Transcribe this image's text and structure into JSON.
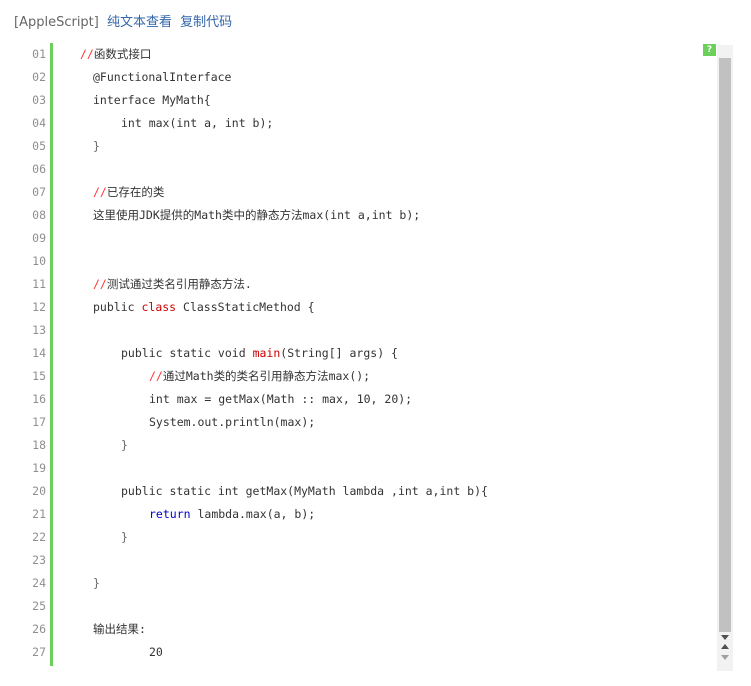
{
  "header": {
    "language": "[AppleScript]",
    "view_plain_link": "纯文本查看",
    "copy_link": "复制代码"
  },
  "badge": {
    "label": "?"
  },
  "lines": [
    {
      "num": "01",
      "indent": 0,
      "segments": [
        {
          "t": "//",
          "c": "c-comment-slash"
        },
        {
          "t": "函数式接口",
          "c": "c-plain cjk"
        }
      ]
    },
    {
      "num": "02",
      "indent": 1,
      "segments": [
        {
          "t": "@FunctionalInterface",
          "c": "c-plain"
        }
      ]
    },
    {
      "num": "03",
      "indent": 1,
      "segments": [
        {
          "t": "interface MyMath{",
          "c": "c-plain"
        }
      ]
    },
    {
      "num": "04",
      "indent": 2,
      "segments": [
        {
          "t": "int max(int a, int b);",
          "c": "c-plain"
        }
      ]
    },
    {
      "num": "05",
      "indent": 1,
      "segments": [
        {
          "t": "}",
          "c": "c-gray"
        }
      ]
    },
    {
      "num": "06",
      "indent": 1,
      "segments": []
    },
    {
      "num": "07",
      "indent": 1,
      "segments": [
        {
          "t": "//",
          "c": "c-comment-slash"
        },
        {
          "t": "已存在的类",
          "c": "c-plain cjk"
        }
      ]
    },
    {
      "num": "08",
      "indent": 1,
      "segments": [
        {
          "t": "这里使用",
          "c": "c-plain cjk"
        },
        {
          "t": "JDK",
          "c": "c-plain"
        },
        {
          "t": "提供的",
          "c": "c-plain cjk"
        },
        {
          "t": "Math",
          "c": "c-plain"
        },
        {
          "t": "类中的静态方法",
          "c": "c-plain cjk"
        },
        {
          "t": "max(int a,int b);",
          "c": "c-plain"
        }
      ]
    },
    {
      "num": "09",
      "indent": 1,
      "segments": []
    },
    {
      "num": "10",
      "indent": 1,
      "segments": []
    },
    {
      "num": "11",
      "indent": 1,
      "segments": [
        {
          "t": "//",
          "c": "c-comment-slash"
        },
        {
          "t": "测试通过类名引用静态方法",
          "c": "c-plain cjk"
        },
        {
          "t": ".",
          "c": "c-plain"
        }
      ]
    },
    {
      "num": "12",
      "indent": 1,
      "segments": [
        {
          "t": "public ",
          "c": "c-plain"
        },
        {
          "t": "class",
          "c": "c-keyword"
        },
        {
          "t": " ClassStaticMethod {",
          "c": "c-plain"
        }
      ]
    },
    {
      "num": "13",
      "indent": 1,
      "segments": []
    },
    {
      "num": "14",
      "indent": 2,
      "segments": [
        {
          "t": "public static void ",
          "c": "c-plain"
        },
        {
          "t": "main",
          "c": "c-keyword"
        },
        {
          "t": "(String[] args) {",
          "c": "c-plain"
        }
      ]
    },
    {
      "num": "15",
      "indent": 3,
      "segments": [
        {
          "t": "//",
          "c": "c-comment-slash"
        },
        {
          "t": "通过",
          "c": "c-plain cjk"
        },
        {
          "t": "Math",
          "c": "c-plain"
        },
        {
          "t": "类的类名引用静态方法",
          "c": "c-plain cjk"
        },
        {
          "t": "max();",
          "c": "c-plain"
        }
      ]
    },
    {
      "num": "16",
      "indent": 3,
      "segments": [
        {
          "t": "int max = getMax(Math :: max, 10, 20);",
          "c": "c-plain"
        }
      ]
    },
    {
      "num": "17",
      "indent": 3,
      "segments": [
        {
          "t": "System.out.println(max);",
          "c": "c-plain"
        }
      ]
    },
    {
      "num": "18",
      "indent": 2,
      "segments": [
        {
          "t": "}",
          "c": "c-gray"
        }
      ]
    },
    {
      "num": "19",
      "indent": 2,
      "segments": []
    },
    {
      "num": "20",
      "indent": 2,
      "segments": [
        {
          "t": "public static int getMax(MyMath lambda ,int a,int b){",
          "c": "c-plain"
        }
      ]
    },
    {
      "num": "21",
      "indent": 3,
      "segments": [
        {
          "t": "return",
          "c": "c-keyword-blue"
        },
        {
          "t": " lambda.max(a, b);",
          "c": "c-plain"
        }
      ]
    },
    {
      "num": "22",
      "indent": 2,
      "segments": [
        {
          "t": "}",
          "c": "c-gray"
        }
      ]
    },
    {
      "num": "23",
      "indent": 2,
      "segments": []
    },
    {
      "num": "24",
      "indent": 1,
      "segments": [
        {
          "t": "}",
          "c": "c-gray"
        }
      ]
    },
    {
      "num": "25",
      "indent": 1,
      "segments": []
    },
    {
      "num": "26",
      "indent": 1,
      "segments": [
        {
          "t": "输出结果",
          "c": "c-plain cjk"
        },
        {
          "t": ":",
          "c": "c-plain"
        }
      ]
    },
    {
      "num": "27",
      "indent": 3,
      "segments": [
        {
          "t": "20",
          "c": "c-plain"
        }
      ]
    }
  ]
}
